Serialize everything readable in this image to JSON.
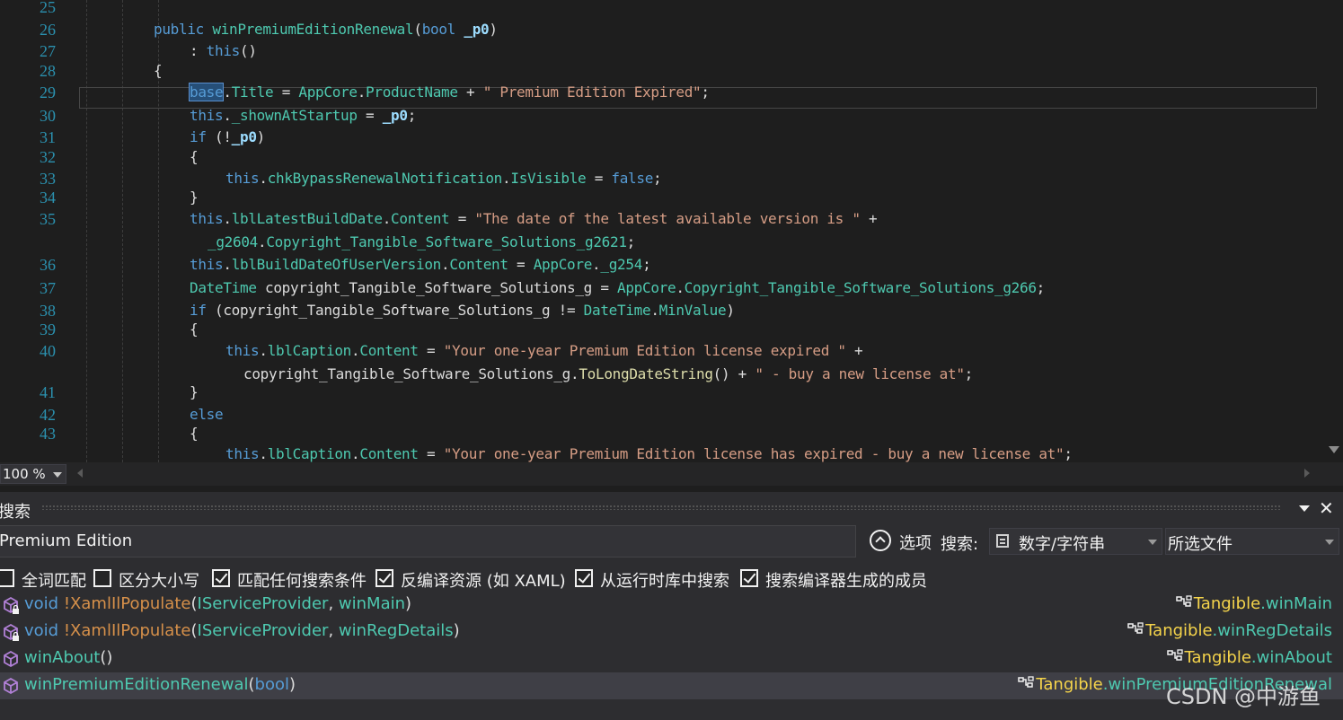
{
  "editor": {
    "lines": [
      {
        "n": "25",
        "segs": []
      },
      {
        "n": "26",
        "segs": [
          [
            "kw",
            "public "
          ],
          [
            "mem",
            "winPremiumEditionRenewal"
          ],
          [
            "pl",
            "("
          ],
          [
            "kw",
            "bool "
          ],
          [
            "prm",
            "_p0"
          ],
          [
            "pl",
            ")"
          ]
        ]
      },
      {
        "n": "27",
        "segs": [
          [
            "pl",
            ": "
          ],
          [
            "kw",
            "this"
          ],
          [
            "pl",
            "()"
          ]
        ]
      },
      {
        "n": "28",
        "segs": [
          [
            "pl",
            "{"
          ]
        ]
      },
      {
        "n": "29",
        "segs": [
          [
            "kwsel",
            "base"
          ],
          [
            "pl",
            "."
          ],
          [
            "mem",
            "Title"
          ],
          [
            "pl",
            " = "
          ],
          [
            "mem",
            "AppCore"
          ],
          [
            "pl",
            "."
          ],
          [
            "mem",
            "ProductName"
          ],
          [
            "pl",
            " + "
          ],
          [
            "str",
            "\" Premium Edition Expired\""
          ],
          [
            "pl",
            ";"
          ]
        ]
      },
      {
        "n": "30",
        "segs": [
          [
            "kw",
            "this"
          ],
          [
            "pl",
            "."
          ],
          [
            "mem",
            "_shownAtStartup"
          ],
          [
            "pl",
            " = "
          ],
          [
            "prm",
            "_p0"
          ],
          [
            "pl",
            ";"
          ]
        ]
      },
      {
        "n": "31",
        "segs": [
          [
            "kw",
            "if "
          ],
          [
            "pl",
            "(!"
          ],
          [
            "prm",
            "_p0"
          ],
          [
            "pl",
            ")"
          ]
        ]
      },
      {
        "n": "32",
        "segs": [
          [
            "pl",
            "{"
          ]
        ]
      },
      {
        "n": "33",
        "segs": [
          [
            "kw",
            "this"
          ],
          [
            "pl",
            "."
          ],
          [
            "mem",
            "chkBypassRenewalNotification"
          ],
          [
            "pl",
            "."
          ],
          [
            "mem",
            "IsVisible"
          ],
          [
            "pl",
            " = "
          ],
          [
            "kw",
            "false"
          ],
          [
            "pl",
            ";"
          ]
        ]
      },
      {
        "n": "34",
        "segs": [
          [
            "pl",
            "}"
          ]
        ]
      },
      {
        "n": "35",
        "segs": [
          [
            "kw",
            "this"
          ],
          [
            "pl",
            "."
          ],
          [
            "mem",
            "lblLatestBuildDate"
          ],
          [
            "pl",
            "."
          ],
          [
            "mem",
            "Content"
          ],
          [
            "pl",
            " = "
          ],
          [
            "str",
            "\"The date of the latest available version is \""
          ],
          [
            "pl",
            " +"
          ]
        ]
      },
      {
        "n": "",
        "segs": [
          [
            "mem",
            "_g2604"
          ],
          [
            "pl",
            "."
          ],
          [
            "mem",
            "Copyright_Tangible_Software_Solutions_g2621"
          ],
          [
            "pl",
            ";"
          ]
        ]
      },
      {
        "n": "36",
        "segs": [
          [
            "kw",
            "this"
          ],
          [
            "pl",
            "."
          ],
          [
            "mem",
            "lblBuildDateOfUserVersion"
          ],
          [
            "pl",
            "."
          ],
          [
            "mem",
            "Content"
          ],
          [
            "pl",
            " = "
          ],
          [
            "mem",
            "AppCore"
          ],
          [
            "pl",
            "."
          ],
          [
            "mem",
            "_g254"
          ],
          [
            "pl",
            ";"
          ]
        ]
      },
      {
        "n": "37",
        "segs": [
          [
            "mem",
            "DateTime "
          ],
          [
            "pl",
            "copyright_Tangible_Software_Solutions_g = "
          ],
          [
            "mem",
            "AppCore"
          ],
          [
            "pl",
            "."
          ],
          [
            "mem",
            "Copyright_Tangible_Software_Solutions_g266"
          ],
          [
            "pl",
            ";"
          ]
        ]
      },
      {
        "n": "38",
        "segs": [
          [
            "kw",
            "if "
          ],
          [
            "pl",
            "(copyright_Tangible_Software_Solutions_g != "
          ],
          [
            "mem",
            "DateTime"
          ],
          [
            "pl",
            "."
          ],
          [
            "mem",
            "MinValue"
          ],
          [
            "pl",
            ")"
          ]
        ]
      },
      {
        "n": "39",
        "segs": [
          [
            "pl",
            "{"
          ]
        ]
      },
      {
        "n": "40",
        "segs": [
          [
            "kw",
            "this"
          ],
          [
            "pl",
            "."
          ],
          [
            "mem",
            "lblCaption"
          ],
          [
            "pl",
            "."
          ],
          [
            "mem",
            "Content"
          ],
          [
            "pl",
            " = "
          ],
          [
            "str",
            "\"Your one-year Premium Edition license expired \""
          ],
          [
            "pl",
            " +"
          ]
        ]
      },
      {
        "n": "",
        "segs": [
          [
            "pl",
            "copyright_Tangible_Software_Solutions_g."
          ],
          [
            "fn",
            "ToLongDateString"
          ],
          [
            "pl",
            "() + "
          ],
          [
            "str",
            "\" - buy a new license at\""
          ],
          [
            "pl",
            ";"
          ]
        ]
      },
      {
        "n": "41",
        "segs": [
          [
            "pl",
            "}"
          ]
        ]
      },
      {
        "n": "42",
        "segs": [
          [
            "kw",
            "else"
          ]
        ]
      },
      {
        "n": "43",
        "segs": [
          [
            "pl",
            "{"
          ]
        ]
      },
      {
        "n": "",
        "segs": [
          [
            "kw",
            "this"
          ],
          [
            "pl",
            "."
          ],
          [
            "mem",
            "lblCaption"
          ],
          [
            "pl",
            "."
          ],
          [
            "mem",
            "Content"
          ],
          [
            "pl",
            " = "
          ],
          [
            "str",
            "\"Your one-year Premium Edition license has expired - buy a new license at\""
          ],
          [
            "pl",
            ";"
          ]
        ]
      }
    ]
  },
  "zoom": {
    "value": "100 %"
  },
  "panel": {
    "title": "搜索",
    "close": "✕",
    "query": "Premium Edition",
    "options_label": "选项",
    "scope_label": "搜索:",
    "kind_value": "数字/字符串",
    "files_value": "所选文件",
    "checkboxes": [
      {
        "label": "全词匹配",
        "checked": false
      },
      {
        "label": "区分大小写",
        "checked": false
      },
      {
        "label": "匹配任何搜索条件",
        "checked": true
      },
      {
        "label": "反编译资源 (如 XAML)",
        "checked": true
      },
      {
        "label": "从运行时库中搜索",
        "checked": true
      },
      {
        "label": "搜索编译器生成的成员",
        "checked": true
      }
    ],
    "results": [
      {
        "void": "void ",
        "name": "!XamlIlPopulate",
        "open": "(",
        "p1": "IServiceProvider",
        "comma": ", ",
        "p2": "winMain",
        "close": ")",
        "ns": "Tangible",
        "cls": ".winMain",
        "locked": true
      },
      {
        "void": "void ",
        "name": "!XamlIlPopulate",
        "open": "(",
        "p1": "IServiceProvider",
        "comma": ", ",
        "p2": "winRegDetails",
        "close": ")",
        "ns": "Tangible",
        "cls": ".winRegDetails",
        "locked": true
      },
      {
        "void": "",
        "name": "winAbout",
        "open": "()",
        "p1": "",
        "comma": "",
        "p2": "",
        "close": "",
        "ns": "Tangible",
        "cls": ".winAbout",
        "locked": false
      },
      {
        "void": "",
        "name": "winPremiumEditionRenewal",
        "open": "(",
        "p1": "bool",
        "comma": "",
        "p2": "",
        "close": ")",
        "ns": "Tangible",
        "cls": ".winPremiumEditionRenewal",
        "locked": false
      }
    ]
  },
  "watermark": "CSDN @中游鱼",
  "colors": {
    "keyword": "#569cd6",
    "type": "#4ec9b0",
    "string": "#d69d85",
    "line_number": "#2b91af",
    "namespace": "#f5d44b"
  }
}
